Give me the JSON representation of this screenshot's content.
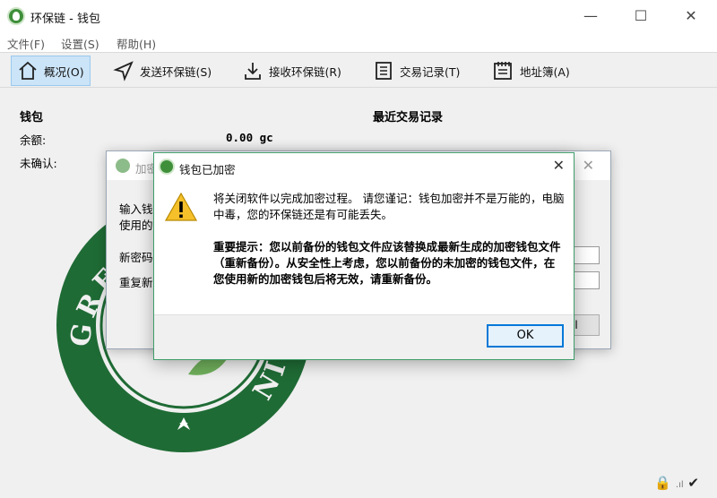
{
  "window": {
    "title": "环保链 - 钱包"
  },
  "menu": [
    "文件(F)",
    "设置(S)",
    "帮助(H)"
  ],
  "toolbar": [
    {
      "label": "概况(O)",
      "icon": "home-icon",
      "active": true
    },
    {
      "label": "发送环保链(S)",
      "icon": "send-icon"
    },
    {
      "label": "接收环保链(R)",
      "icon": "receive-icon"
    },
    {
      "label": "交易记录(T)",
      "icon": "transactions-icon"
    },
    {
      "label": "地址簿(A)",
      "icon": "address-book-icon"
    }
  ],
  "overview": {
    "wallet_title": "钱包",
    "balance_label": "余额:",
    "balance_value": "0.00 gc",
    "unconfirmed_label": "未确认:",
    "recent_tx_title": "最近交易记录"
  },
  "logo_text": {
    "top": "GREEN CHAIN",
    "right": "NIO"
  },
  "back_dialog": {
    "title": "加密",
    "line1": "输入钱",
    "line2": "使用的",
    "new_pass_label": "新密码",
    "repeat_pass_label": "重复新",
    "button_fragment": "l"
  },
  "front_dialog": {
    "title": "钱包已加密",
    "message": "将关闭软件以完成加密过程。 请您谨记：钱包加密并不是万能的，电脑中毒，您的环保链还是有可能丢失。",
    "important": "重要提示：您以前备份的钱包文件应该替换成最新生成的加密钱包文件（重新备份）。从安全性上考虑，您以前备份的未加密的钱包文件，在您使用新的加密钱包后将无效，请重新备份。",
    "ok_label": "OK"
  },
  "status": {
    "icons": [
      "lock-icon",
      "signal-icon",
      "check-icon"
    ]
  },
  "colors": {
    "brand_green": "#2e7d32",
    "accent_blue": "#0078d7"
  }
}
